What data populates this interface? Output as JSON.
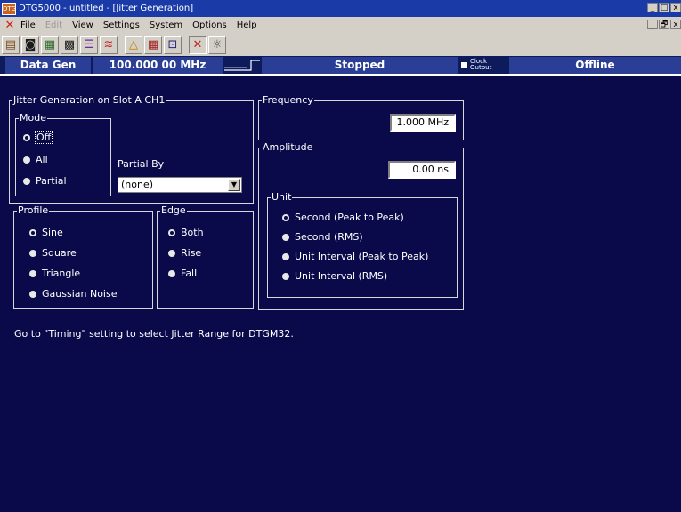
{
  "window": {
    "app_icon_text": "DTG",
    "title": "DTG5000 - untitled - [Jitter Generation]",
    "controls": [
      "_",
      "□",
      "x"
    ],
    "mdi_controls": [
      "_",
      "🗗",
      "x"
    ]
  },
  "menu": [
    {
      "label": "File",
      "enabled": true
    },
    {
      "label": "Edit",
      "enabled": false
    },
    {
      "label": "View",
      "enabled": true
    },
    {
      "label": "Settings",
      "enabled": true
    },
    {
      "label": "System",
      "enabled": true
    },
    {
      "label": "Options",
      "enabled": true
    },
    {
      "label": "Help",
      "enabled": true
    }
  ],
  "toolbar_icons": [
    "open-icon",
    "save-icon",
    "setup-icon",
    "pattern-icon",
    "level-icon",
    "timing-icon",
    "warning-icon",
    "grid-icon",
    "channel-icon",
    "jitter-icon",
    "lamp-icon"
  ],
  "status": {
    "mode": "Data Gen",
    "frequency": "100.000 00 MHz",
    "run_state": "Stopped",
    "clock_output_line1": "Clock",
    "clock_output_line2": "Output",
    "online_state": "Offline"
  },
  "jitter": {
    "group_label": "Jitter Generation on Slot A CH1",
    "mode": {
      "label": "Mode",
      "options": [
        "Off",
        "All",
        "Partial"
      ],
      "selected": "Off"
    },
    "partial_by": {
      "label": "Partial By",
      "value": "(none)"
    }
  },
  "profile": {
    "label": "Profile",
    "options": [
      "Sine",
      "Square",
      "Triangle",
      "Gaussian Noise"
    ],
    "selected": "Sine"
  },
  "edge": {
    "label": "Edge",
    "options": [
      "Both",
      "Rise",
      "Fall"
    ],
    "selected": "Both"
  },
  "frequency": {
    "label": "Frequency",
    "value": "1.000 MHz"
  },
  "amplitude": {
    "label": "Amplitude",
    "value": "0.00 ns",
    "unit": {
      "label": "Unit",
      "options": [
        "Second (Peak to Peak)",
        "Second (RMS)",
        "Unit Interval (Peak to Peak)",
        "Unit Interval (RMS)"
      ],
      "selected": "Second (Peak to Peak)"
    }
  },
  "note": "Go to \"Timing\" setting to select Jitter Range for DTGM32."
}
